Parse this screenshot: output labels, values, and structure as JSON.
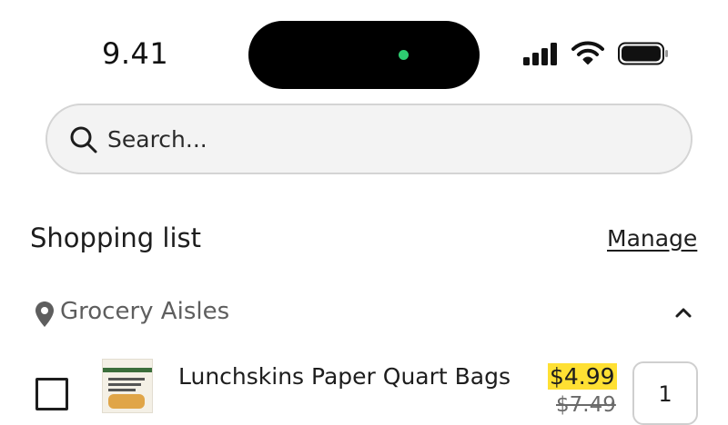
{
  "status_bar": {
    "time": "9.41",
    "icons": [
      "cellular-signal-icon",
      "wifi-icon",
      "battery-icon"
    ]
  },
  "search": {
    "placeholder": "Search...",
    "icon": "search-icon"
  },
  "shopping_list": {
    "title": "Shopping list",
    "manage_label": "Manage"
  },
  "section": {
    "icon": "location-pin-icon",
    "label": "Grocery Aisles",
    "expanded": true
  },
  "items": [
    {
      "name": "Lunchskins Paper Quart Bags",
      "sale_price": "$4.99",
      "original_price": "$7.49",
      "quantity": "1",
      "checked": false
    }
  ],
  "colors": {
    "price_highlight": "#ffe033",
    "status_dot": "#2ecc71",
    "search_background": "#f3f3f3"
  }
}
